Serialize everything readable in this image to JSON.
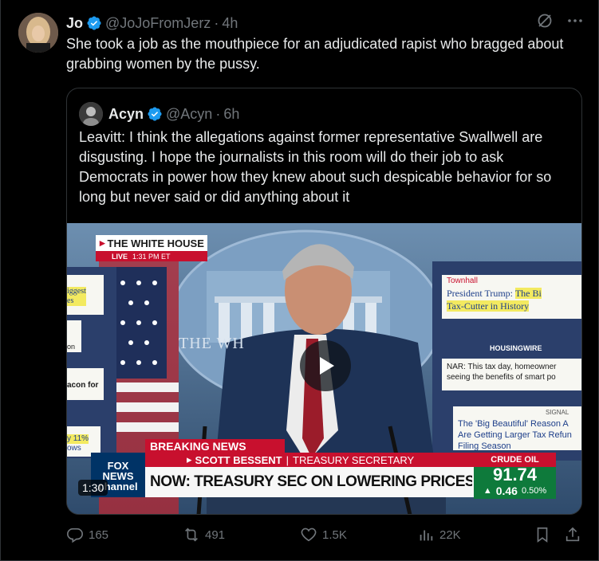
{
  "tweet": {
    "author_name": "Jo",
    "author_handle": "@JoJoFromJerz",
    "separator": "·",
    "time": "4h",
    "text": "She took a job as the mouthpiece for an adjudicated rapist who bragged about grabbing women by the pussy."
  },
  "quote": {
    "author_name": "Acyn",
    "author_handle": "@Acyn",
    "separator": "·",
    "time": "6h",
    "text": "Leavitt: I think the allegations against former representative Swallwell are disgusting. I hope the journalists in this room will do their job to ask Democrats in power how they knew about such despicable behavior for so long but never said or did anything about it"
  },
  "video": {
    "duration": "1:30",
    "location_label": "THE WHITE HOUSE",
    "live_label": "LIVE",
    "live_time": "1:31 PM ET",
    "breaking_label": "BREAKING NEWS",
    "name_label": "SCOTT BESSENT",
    "title_label": "TREASURY SECRETARY",
    "headline": "NOW: TREASURY SEC ON LOWERING PRICES FOR AMERICANS",
    "ticker_label": "CRUDE OIL",
    "ticker_value": "91.74",
    "ticker_change": "0.46",
    "ticker_pct": "0.50%",
    "network_logo": "FOX NEWS channel",
    "podium_seal_text": "THE WH",
    "screen_right": {
      "source_1": "Townhall",
      "headline_1a": "President Trump:",
      "headline_1b": "The Bi",
      "headline_1c": "Tax-Cutter in History",
      "source_2": "HOUSINGWIRE",
      "headline_2a": "NAR: This tax day, homeowner",
      "headline_2b": "seeing the benefits of smart po",
      "source_3": "SIGNAL",
      "headline_3a": "The 'Big Beautiful' Reason A",
      "headline_3b": "Are Getting Larger Tax Refun",
      "headline_3c": "Filing Season"
    },
    "screen_left": {
      "line_1": "iggest",
      "line_2": "es",
      "line_3": "on",
      "line_4": "acon for",
      "line_5": "y 11%",
      "line_6": "ows"
    }
  },
  "actions": {
    "replies": "165",
    "reposts": "491",
    "likes": "1.5K",
    "views": "22K"
  },
  "colors": {
    "background": "#000000",
    "text": "#e7e9ea",
    "muted": "#71767b",
    "verified": "#1d9bf0",
    "border": "#2f3336"
  }
}
